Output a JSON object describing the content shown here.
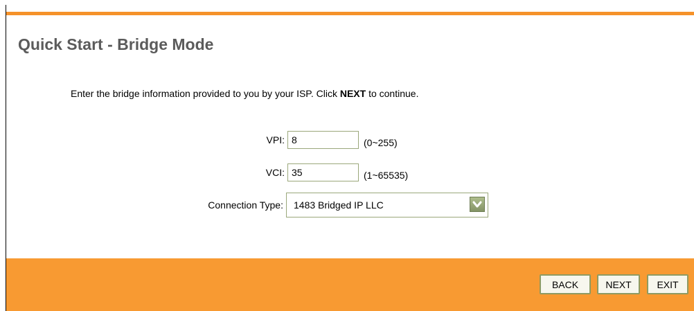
{
  "page": {
    "title": "Quick Start - Bridge Mode",
    "instructions_before": "Enter the bridge information provided to you by your ISP. Click ",
    "instructions_emphasis": "NEXT",
    "instructions_after": " to continue."
  },
  "form": {
    "vpi": {
      "label": "VPI:",
      "value": "8",
      "range": "(0~255)"
    },
    "vci": {
      "label": "VCI:",
      "value": "35",
      "range": "(1~65535)"
    },
    "connection_type": {
      "label": "Connection Type:",
      "selected": "1483 Bridged IP LLC",
      "icon": "chevron-down-icon"
    }
  },
  "buttons": {
    "back": "BACK",
    "next": "NEXT",
    "exit": "EXIT"
  },
  "colors": {
    "accent_orange": "#f89a32",
    "title_gray": "#5b5b5b",
    "field_border": "#9aa77a"
  }
}
